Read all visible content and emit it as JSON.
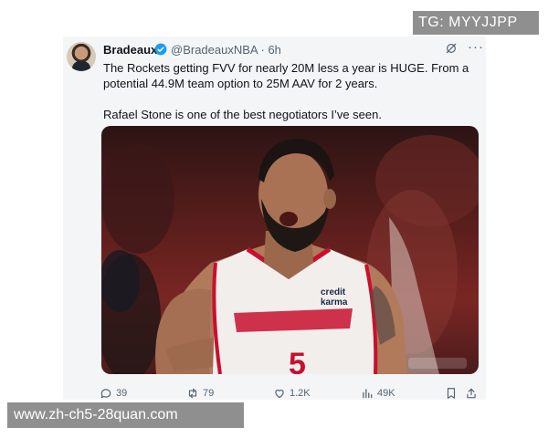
{
  "post": {
    "author_name": "Bradeaux",
    "author_handle": "@BradeauxNBA",
    "separator": "·",
    "time": "6h",
    "text_line1": "The Rockets getting FVV for nearly 20M less a year is HUGE. From a potential 44.9M team option to 25M AAV for 2 years.",
    "text_line2": "Rafael Stone is one of the best negotiators I’ve seen.",
    "more_menu": "···",
    "media": {
      "jersey_sponsor_line1": "credit",
      "jersey_sponsor_line2": "karma",
      "jersey_number": "5"
    },
    "stats": {
      "replies": "39",
      "reposts": "79",
      "likes": "1.2K",
      "views": "49K"
    }
  },
  "watermarks": {
    "tg": "TG: MYYJJPP",
    "url": "www.zh-ch5-28quan.com"
  },
  "icons": {
    "verified": "verified-badge-icon",
    "grok": "grok-icon",
    "reply": "reply-icon",
    "repost": "repost-icon",
    "like": "like-icon",
    "views": "views-icon",
    "bookmark": "bookmark-icon",
    "share": "share-icon"
  },
  "colors": {
    "verified_blue": "#1d9bf0",
    "jersey_red": "#c8102e",
    "text_secondary": "#536471"
  }
}
